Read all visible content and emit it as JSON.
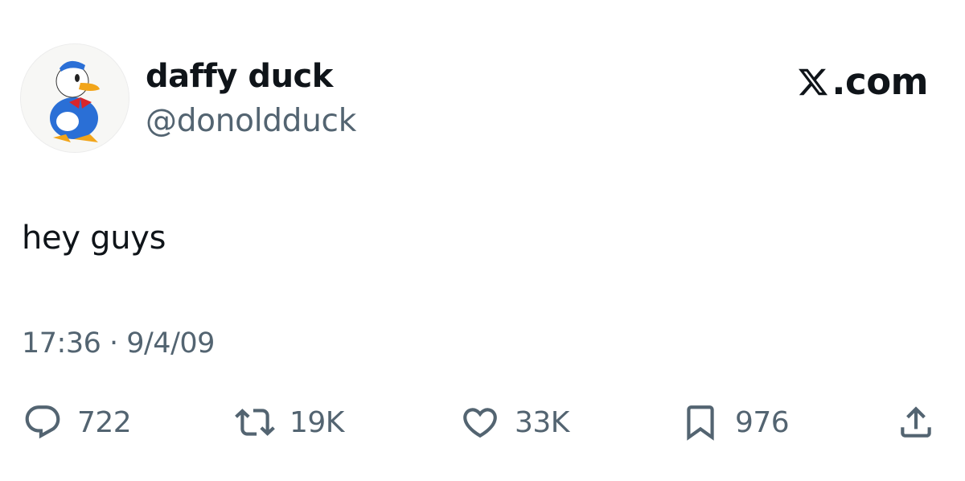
{
  "author": {
    "display_name": "daffy duck",
    "handle": "@donoldduck",
    "avatar_icon": "donald-duck-avatar"
  },
  "brand": {
    "label": ".com",
    "icon": "x-logo-icon"
  },
  "tweet": {
    "text": "hey guys",
    "timestamp": "17:36 · 9/4/09"
  },
  "actions": {
    "reply": {
      "icon": "reply-icon",
      "count": "722"
    },
    "repost": {
      "icon": "repost-icon",
      "count": "19K"
    },
    "like": {
      "icon": "heart-icon",
      "count": "33K"
    },
    "bookmark": {
      "icon": "bookmark-icon",
      "count": "976"
    },
    "share": {
      "icon": "share-icon"
    }
  },
  "colors": {
    "text_primary": "#0f1419",
    "text_secondary": "#536471",
    "background": "#ffffff"
  }
}
